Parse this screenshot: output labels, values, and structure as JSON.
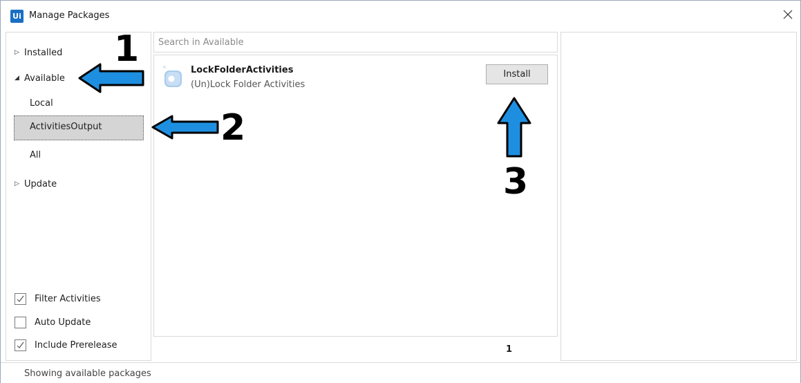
{
  "window": {
    "title": "Manage Packages",
    "app_icon_text": "Ui",
    "accent_color": "#1a6fc4"
  },
  "nav": {
    "installed_label": "Installed",
    "available_label": "Available",
    "local_label": "Local",
    "activities_output_label": "ActivitiesOutput",
    "all_label": "All",
    "update_label": "Update"
  },
  "options": {
    "filter_activities": {
      "label": "Filter Activities",
      "checked": true
    },
    "auto_update": {
      "label": "Auto Update",
      "checked": false
    },
    "include_prerelease": {
      "label": "Include Prerelease",
      "checked": true
    }
  },
  "search": {
    "placeholder": "Search in Available",
    "value": ""
  },
  "packages": [
    {
      "name": "LockFolderActivities",
      "description": "(Un)Lock Folder Activities",
      "action_label": "Install",
      "icon": "package-icon"
    }
  ],
  "pager": {
    "page": "1"
  },
  "status": {
    "text": "Showing available packages"
  },
  "annotations": {
    "step1": "1",
    "step2": "2",
    "step3": "3",
    "arrow_color": "#1e8fe0"
  }
}
